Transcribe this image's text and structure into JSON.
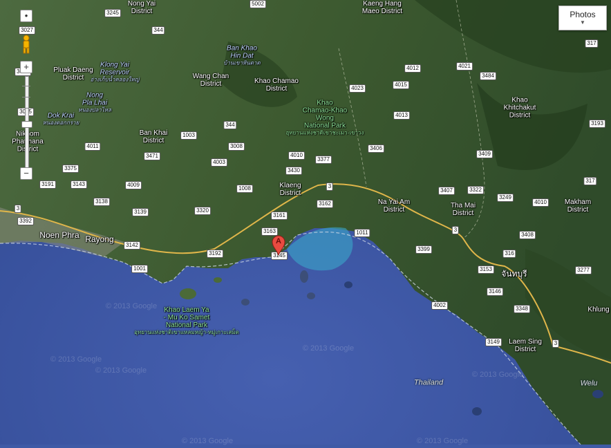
{
  "map": {
    "type": "satellite",
    "colors": {
      "sea": "#3f5aa6",
      "land": "#3b5a32",
      "road": "#e0b64a",
      "coast_shallow": "#3aa6c9"
    },
    "labels": [
      {
        "id": "nong-yai",
        "lines": [
          "Nong Yai",
          "District"
        ]
      },
      {
        "id": "kaeng-hang-maeo",
        "lines": [
          "Kaeng Hang",
          "Maeo District"
        ]
      },
      {
        "id": "ban-khao-hin-dat",
        "lines": [
          "Ban Khao",
          "Hin Dat"
        ],
        "thai": "บ้านเขาหินดาด"
      },
      {
        "id": "klong-yai-reservoir",
        "lines": [
          "Klong Yai",
          "Reservoir"
        ],
        "thai": "อ่างเก็บน้ำคลองใหญ่"
      },
      {
        "id": "pluak-daeng",
        "lines": [
          "Pluak Daeng",
          "District"
        ]
      },
      {
        "id": "wang-chan",
        "lines": [
          "Wang Chan",
          "District"
        ]
      },
      {
        "id": "khao-chamao",
        "lines": [
          "Khao Chamao",
          "District"
        ]
      },
      {
        "id": "nong-pla-lhai",
        "lines": [
          "Nong",
          "Pla Lhai"
        ],
        "thai": "หนองปลาไหล"
      },
      {
        "id": "khao-chamao-park",
        "lines": [
          "Khao",
          "Chamao-Khao",
          "Wong",
          "National Park"
        ],
        "thai": "อุทยานแห่งชาติเขาชะเมา-เขาวง"
      },
      {
        "id": "dok-krai",
        "lines": [
          "Dok Krai"
        ],
        "thai": "หนองดอกกราย"
      },
      {
        "id": "khao-khitchakut",
        "lines": [
          "Khao",
          "Khitchakut",
          "District"
        ]
      },
      {
        "id": "nikhom-phatthana",
        "lines": [
          "Nikhom",
          "Phatthana",
          "District"
        ]
      },
      {
        "id": "ban-khai",
        "lines": [
          "Ban Khai",
          "District"
        ]
      },
      {
        "id": "klaeng",
        "lines": [
          "Klaeng",
          "District"
        ]
      },
      {
        "id": "na-yai-am",
        "lines": [
          "Na Yai Am",
          "District"
        ]
      },
      {
        "id": "tha-mai",
        "lines": [
          "Tha Mai",
          "District"
        ]
      },
      {
        "id": "makham",
        "lines": [
          "Makham",
          "District"
        ]
      },
      {
        "id": "noen-phra",
        "lines": [
          "Noen Phra"
        ]
      },
      {
        "id": "rayong",
        "lines": [
          "Rayong"
        ]
      },
      {
        "id": "chanthaburi-thai",
        "lines": [
          "จันทบุรี"
        ]
      },
      {
        "id": "khao-laem-ya-park",
        "lines": [
          "Khao Laem Ya",
          "- Mu Ko Samet",
          "National Park"
        ],
        "thai": "อุทยานแห่งชาติเขาแหลมหญ้า-หมู่เกาะเสม็ด"
      },
      {
        "id": "laem-sing",
        "lines": [
          "Laem Sing",
          "District"
        ]
      },
      {
        "id": "khlung",
        "lines": [
          "Khlung"
        ]
      },
      {
        "id": "thailand",
        "lines": [
          "Thailand"
        ]
      },
      {
        "id": "welu",
        "lines": [
          "Welu"
        ]
      }
    ],
    "road_shields": [
      "3245",
      "5002",
      "344",
      "3027",
      "3013",
      "3015",
      "4012",
      "4021",
      "3484",
      "317",
      "4023",
      "4015",
      "1003",
      "344",
      "4013",
      "3193",
      "3008",
      "3471",
      "4011",
      "3406",
      "3409",
      "4003",
      "3375",
      "4010",
      "3430",
      "3377",
      "317",
      "3191",
      "3143",
      "4009",
      "1008",
      "3",
      "3407",
      "3322",
      "3249",
      "4010",
      "3138",
      "3139",
      "3320",
      "3162",
      "3161",
      "3",
      "3392",
      "3163",
      "1011",
      "3",
      "3408",
      "3142",
      "3192",
      "3145",
      "3399",
      "316",
      "1001",
      "3153",
      "3277",
      "3146",
      "4002",
      "3348",
      "3149",
      "3"
    ],
    "watermarks": [
      "© 2013 Google",
      "© 2013 Google",
      "© 2013 Google",
      "© 2013 Google",
      "© 2013 Google",
      "© 2013 Google",
      "© 2013 Google"
    ],
    "marker": {
      "label": "A"
    },
    "controls": {
      "photos_label": "Photos",
      "zoom_in": "+",
      "zoom_out": "−"
    }
  }
}
